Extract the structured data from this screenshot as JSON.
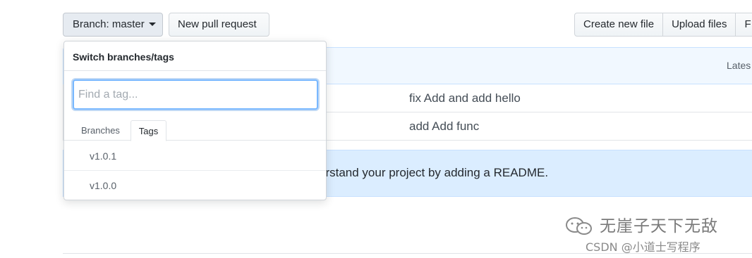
{
  "toolbar": {
    "branch_button_label": "Branch: master",
    "new_pull_request_label": "New pull request",
    "create_new_file_label": "Create new file",
    "upload_files_label": "Upload files",
    "find_file_partial_label": "F"
  },
  "commit_header": {
    "latest_partial": "Lates"
  },
  "file_rows": [
    {
      "commit_message": "fix Add and add hello"
    },
    {
      "commit_message": "add Add func"
    }
  ],
  "readme_banner": {
    "text_partial": "erstand your project by adding a README."
  },
  "branch_dropdown": {
    "title": "Switch branches/tags",
    "filter_placeholder": "Find a tag...",
    "tabs": [
      {
        "label": "Branches",
        "selected": false
      },
      {
        "label": "Tags",
        "selected": true
      }
    ],
    "items": [
      {
        "label": "v1.0.1"
      },
      {
        "label": "v1.0.0"
      }
    ]
  },
  "watermark": {
    "title": "无崖子天下无敌",
    "subtitle": "CSDN @小道士写程序",
    "icon": "wechat-icon"
  },
  "colors": {
    "focus_ring": "#79b8ff",
    "header_bg": "#f1f8ff",
    "banner_bg": "#dbedff"
  }
}
